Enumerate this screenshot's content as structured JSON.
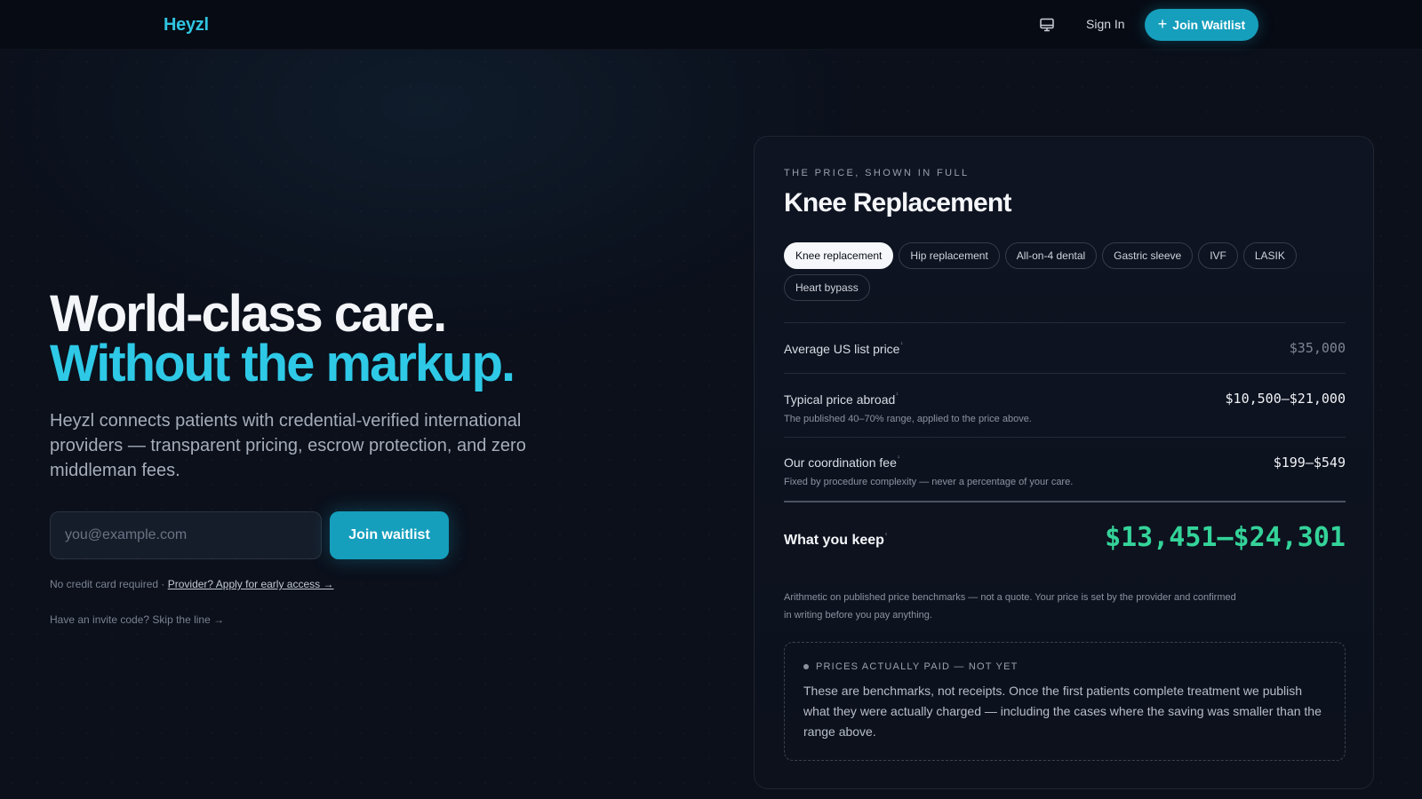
{
  "header": {
    "brand": "Heyzl",
    "sign_in": "Sign In",
    "join_waitlist": "Join Waitlist",
    "icons": {
      "display": "monitor-icon",
      "join": "plus-icon"
    }
  },
  "hero": {
    "title_line1": "World-class care.",
    "title_line2": "Without the markup.",
    "subtitle": "Heyzl connects patients with credential-verified international providers — transparent pricing, escrow protection, and zero middleman fees.",
    "email_placeholder": "you@example.com",
    "email_value": "",
    "join_button": "Join waitlist",
    "fine_print": "No credit card required · ",
    "provider_link": "Provider? Apply for early access →",
    "invite_link": "Have an invite code? Skip the line →"
  },
  "price_card": {
    "eyebrow": "THE PRICE, SHOWN IN FULL",
    "title": "Knee Replacement",
    "procedures": [
      {
        "label": "Knee replacement",
        "active": true
      },
      {
        "label": "Hip replacement",
        "active": false
      },
      {
        "label": "All-on-4 dental",
        "active": false
      },
      {
        "label": "Gastric sleeve",
        "active": false
      },
      {
        "label": "IVF",
        "active": false
      },
      {
        "label": "LASIK",
        "active": false
      },
      {
        "label": "Heart bypass",
        "active": false
      }
    ],
    "rows": {
      "us_price": {
        "label": "Average US list price",
        "value": "$35,000"
      },
      "abroad": {
        "label": "Typical price abroad",
        "note": "The published 40–70% range, applied to the price above.",
        "value": "$10,500–$21,000"
      },
      "fee": {
        "label": "Our coordination fee",
        "note": "Fixed by procedure complexity — never a percentage of your care.",
        "value": "$199–$549"
      },
      "keep": {
        "label": "What you keep",
        "value": "$13,451–$24,301"
      }
    },
    "footnote_mark": "¹",
    "disclaimer": "Arithmetic on published price benchmarks — not a quote. Your price is set by the provider and confirmed in writing before you pay anything.",
    "callout": {
      "heading": "PRICES ACTUALLY PAID — NOT YET",
      "body": "These are benchmarks, not receipts. Once the first patients complete treatment we publish what they were actually charged — including the cases where the saving was smaller than the range above."
    }
  },
  "colors": {
    "accent": "#2ec9e6",
    "button": "#169fbd",
    "savings": "#34d399",
    "background": "#0b101b"
  }
}
